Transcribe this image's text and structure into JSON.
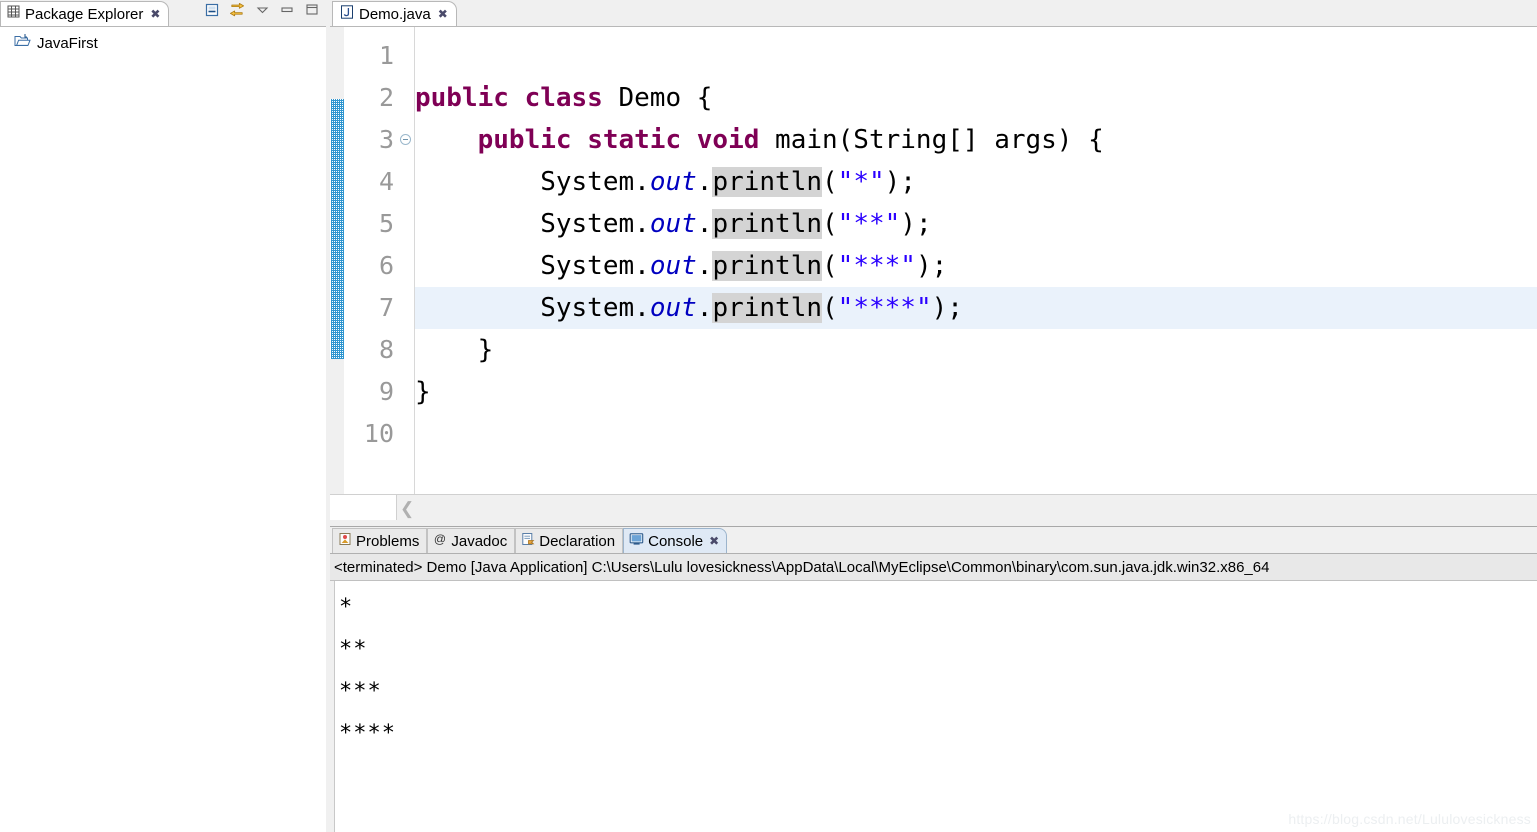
{
  "package_explorer": {
    "tab_title": "Package Explorer",
    "tab_close": "✖",
    "view_icon": "package-explorer-icon",
    "toolbar": [
      {
        "name": "collapse-all-icon",
        "label": "Collapse All"
      },
      {
        "name": "link-with-editor-icon",
        "label": "Link with Editor"
      },
      {
        "name": "view-menu-icon",
        "label": "View Menu"
      },
      {
        "name": "minimize-icon",
        "label": "Minimize"
      },
      {
        "name": "maximize-icon",
        "label": "Maximize"
      }
    ],
    "tree": [
      {
        "icon": "java-project-folder-icon",
        "label": "JavaFirst"
      }
    ]
  },
  "editor": {
    "tab_title": "Demo.java",
    "tab_close": "✖",
    "file_icon": "java-file-icon",
    "line_numbers": [
      "1",
      "2",
      "3",
      "4",
      "5",
      "6",
      "7",
      "8",
      "9",
      "10"
    ],
    "current_line": 7,
    "fold_marker_line": 3,
    "occurrence_token": "println",
    "code": [
      {
        "line": 1,
        "text": ""
      },
      {
        "line": 2,
        "text": "public class Demo {"
      },
      {
        "line": 3,
        "text": "    public static void main(String[] args) {"
      },
      {
        "line": 4,
        "text": "        System.out.println(\"*\");"
      },
      {
        "line": 5,
        "text": "        System.out.println(\"**\");"
      },
      {
        "line": 6,
        "text": "        System.out.println(\"***\");"
      },
      {
        "line": 7,
        "text": "        System.out.println(\"****\");"
      },
      {
        "line": 8,
        "text": "    }"
      },
      {
        "line": 9,
        "text": "}"
      },
      {
        "line": 10,
        "text": ""
      }
    ],
    "scroll_left_arrow": "❮",
    "colors": {
      "keyword": "#7f0055",
      "static_field": "#0000c0",
      "string": "#2a00ff",
      "plain": "#000000",
      "occurrence_highlight": "#d4d4d4",
      "current_line_highlight": "#eaf2fb",
      "annotation_marker": "#0a84c8"
    }
  },
  "bottom_panel": {
    "tabs": [
      {
        "label": "Problems",
        "icon": "problems-icon",
        "active": false
      },
      {
        "label": "Javadoc",
        "icon": "javadoc-at-icon",
        "active": false
      },
      {
        "label": "Declaration",
        "icon": "declaration-icon",
        "active": false
      },
      {
        "label": "Console",
        "icon": "console-icon",
        "active": true
      }
    ],
    "active_tab_close": "✖",
    "console_header": "<terminated> Demo [Java Application] C:\\Users\\Lulu lovesickness\\AppData\\Local\\MyEclipse\\Common\\binary\\com.sun.java.jdk.win32.x86_64",
    "console_output": [
      "*",
      "**",
      "***",
      "****"
    ]
  },
  "watermark": "https://blog.csdn.net/Lululovesickness"
}
